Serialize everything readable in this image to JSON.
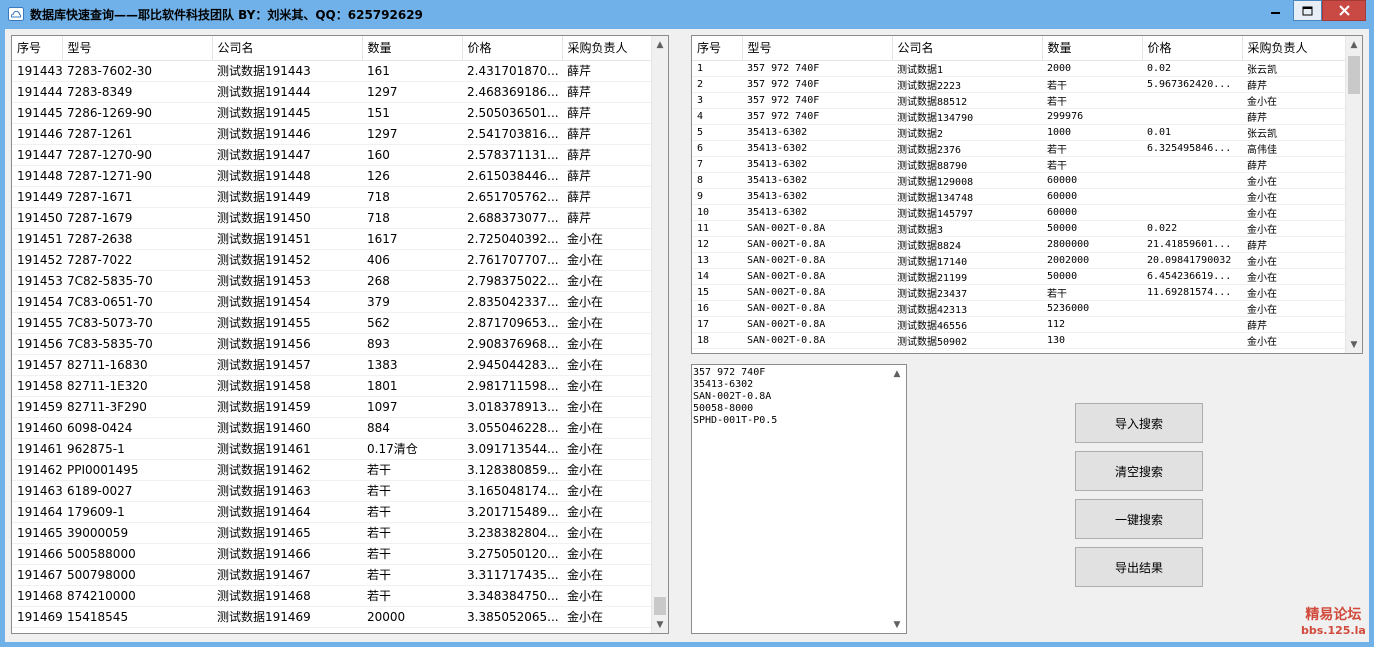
{
  "window": {
    "title": "数据库快速查询——耶比软件科技团队 BY：刘米其、QQ：625792629",
    "icon": "cloud-icon"
  },
  "left_grid": {
    "columns": [
      "序号",
      "型号",
      "公司名",
      "数量",
      "价格",
      "采购负责人"
    ],
    "rows": [
      [
        "191443",
        "7283-7602-30",
        "测试数据191443",
        "161",
        "2.431701870...",
        "薛芹"
      ],
      [
        "191444",
        "7283-8349",
        "测试数据191444",
        "1297",
        "2.468369186...",
        "薛芹"
      ],
      [
        "191445",
        "7286-1269-90",
        "测试数据191445",
        "151",
        "2.505036501...",
        "薛芹"
      ],
      [
        "191446",
        "7287-1261",
        "测试数据191446",
        "1297",
        "2.541703816...",
        "薛芹"
      ],
      [
        "191447",
        "7287-1270-90",
        "测试数据191447",
        "160",
        "2.578371131...",
        "薛芹"
      ],
      [
        "191448",
        "7287-1271-90",
        "测试数据191448",
        "126",
        "2.615038446...",
        "薛芹"
      ],
      [
        "191449",
        "7287-1671",
        "测试数据191449",
        "718",
        "2.651705762...",
        "薛芹"
      ],
      [
        "191450",
        "7287-1679",
        "测试数据191450",
        "718",
        "2.688373077...",
        "薛芹"
      ],
      [
        "191451",
        "7287-2638",
        "测试数据191451",
        "1617",
        "2.725040392...",
        "金小在"
      ],
      [
        "191452",
        "7287-7022",
        "测试数据191452",
        "406",
        "2.761707707...",
        "金小在"
      ],
      [
        "191453",
        "7C82-5835-70",
        "测试数据191453",
        "268",
        "2.798375022...",
        "金小在"
      ],
      [
        "191454",
        "7C83-0651-70",
        "测试数据191454",
        "379",
        "2.835042337...",
        "金小在"
      ],
      [
        "191455",
        "7C83-5073-70",
        "测试数据191455",
        "562",
        "2.871709653...",
        "金小在"
      ],
      [
        "191456",
        "7C83-5835-70",
        "测试数据191456",
        "893",
        "2.908376968...",
        "金小在"
      ],
      [
        "191457",
        "82711-16830",
        "测试数据191457",
        "1383",
        "2.945044283...",
        "金小在"
      ],
      [
        "191458",
        "82711-1E320",
        "测试数据191458",
        "1801",
        "2.981711598...",
        "金小在"
      ],
      [
        "191459",
        "82711-3F290",
        "测试数据191459",
        "1097",
        "3.018378913...",
        "金小在"
      ],
      [
        "191460",
        "6098-0424",
        "测试数据191460",
        "884",
        "3.055046228...",
        "金小在"
      ],
      [
        "191461",
        "962875-1",
        "测试数据191461",
        "0.17清仓",
        "3.091713544...",
        "金小在"
      ],
      [
        "191462",
        "PPI0001495",
        "测试数据191462",
        "若干",
        "3.128380859...",
        "金小在"
      ],
      [
        "191463",
        "6189-0027",
        "测试数据191463",
        "若干",
        "3.165048174...",
        "金小在"
      ],
      [
        "191464",
        "179609-1",
        "测试数据191464",
        "若干",
        "3.201715489...",
        "金小在"
      ],
      [
        "191465",
        "39000059",
        "测试数据191465",
        "若干",
        "3.238382804...",
        "金小在"
      ],
      [
        "191466",
        "500588000",
        "测试数据191466",
        "若干",
        "3.275050120...",
        "金小在"
      ],
      [
        "191467",
        "500798000",
        "测试数据191467",
        "若干",
        "3.311717435...",
        "金小在"
      ],
      [
        "191468",
        "874210000",
        "测试数据191468",
        "若干",
        "3.348384750...",
        "金小在"
      ],
      [
        "191469",
        "15418545",
        "测试数据191469",
        "20000",
        "3.385052065...",
        "金小在"
      ]
    ]
  },
  "right_grid": {
    "columns": [
      "序号",
      "型号",
      "公司名",
      "数量",
      "价格",
      "采购负责人"
    ],
    "rows": [
      [
        "1",
        "357 972 740F",
        "测试数据1",
        "2000",
        "0.02",
        "张云凯"
      ],
      [
        "2",
        "357 972 740F",
        "测试数据2223",
        "若干",
        "5.967362420...",
        "薛芹"
      ],
      [
        "3",
        "357 972 740F",
        "测试数据88512",
        "若干",
        "",
        "金小在"
      ],
      [
        "4",
        "357 972 740F",
        "测试数据134790",
        "299976",
        "",
        "薛芹"
      ],
      [
        "5",
        "35413-6302",
        "测试数据2",
        "1000",
        "0.01",
        "张云凯"
      ],
      [
        "6",
        "35413-6302",
        "测试数据2376",
        "若干",
        "6.325495846...",
        "高伟佳"
      ],
      [
        "7",
        "35413-6302",
        "测试数据88790",
        "若干",
        "",
        "薛芹"
      ],
      [
        "8",
        "35413-6302",
        "测试数据129008",
        "60000",
        "",
        "金小在"
      ],
      [
        "9",
        "35413-6302",
        "测试数据134748",
        "60000",
        "",
        "金小在"
      ],
      [
        "10",
        "35413-6302",
        "测试数据145797",
        "60000",
        "",
        "金小在"
      ],
      [
        "11",
        "SAN-002T-0.8A",
        "测试数据3",
        "50000",
        "0.022",
        "金小在"
      ],
      [
        "12",
        "SAN-002T-0.8A",
        "测试数据8824",
        "2800000",
        "21.41859601...",
        "薛芹"
      ],
      [
        "13",
        "SAN-002T-0.8A",
        "测试数据17140",
        "2002000",
        "20.09841790032",
        "金小在"
      ],
      [
        "14",
        "SAN-002T-0.8A",
        "测试数据21199",
        "50000",
        "6.454236619...",
        "金小在"
      ],
      [
        "15",
        "SAN-002T-0.8A",
        "测试数据23437",
        "若干",
        "11.69281574...",
        "金小在"
      ],
      [
        "16",
        "SAN-002T-0.8A",
        "测试数据42313",
        "5236000",
        "",
        "金小在"
      ],
      [
        "17",
        "SAN-002T-0.8A",
        "测试数据46556",
        "112",
        "",
        "薛芹"
      ],
      [
        "18",
        "SAN-002T-0.8A",
        "测试数据50902",
        "130",
        "",
        "金小在"
      ]
    ]
  },
  "query_text": {
    "lines": [
      "357 972 740F",
      "35413-6302",
      "SAN-002T-0.8A",
      "50058-8000",
      "SPHD-001T-P0.5"
    ]
  },
  "buttons": {
    "import": "导入搜索",
    "clear": "清空搜索",
    "one_click": "一键搜索",
    "export": "导出结果"
  },
  "watermark": {
    "name": "精易论坛",
    "url": "bbs.125.la"
  },
  "colors": {
    "title_bar": "#6fb1e8",
    "close_button": "#c94a44",
    "watermark": "#d14a3c"
  }
}
